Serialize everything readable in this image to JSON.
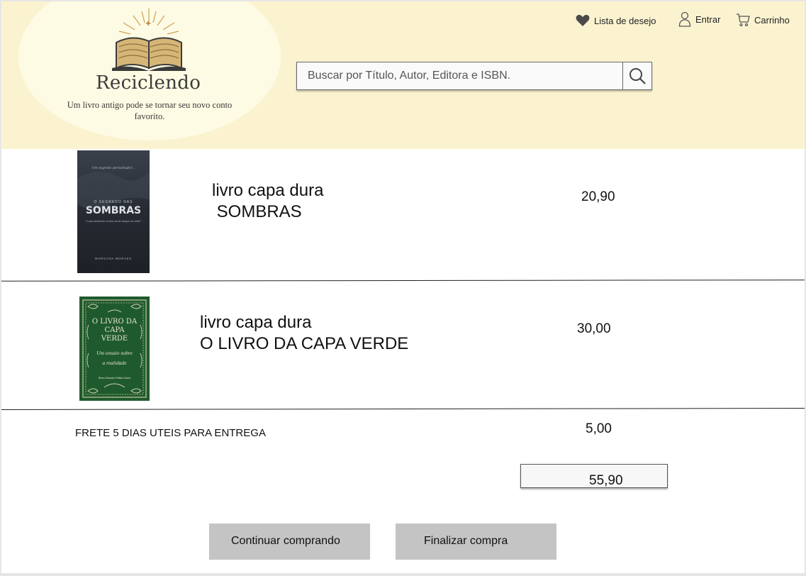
{
  "header": {
    "brand_name": "Reciclendo",
    "tagline": "Um livro antigo pode se tornar seu novo conto favorito.",
    "nav": {
      "wishlist_label": "Lista de desejo",
      "login_label": "Entrar",
      "cart_label": "Carrinho"
    },
    "search": {
      "placeholder": "Buscar por Título, Autor, Editora e ISBN."
    }
  },
  "cart": {
    "items": [
      {
        "line1": "livro capa dura",
        "line2": " SOMBRAS",
        "price": "20,90",
        "cover": {
          "top_text": "Um segredo perturbador...",
          "small_title": "O SEGREDO NAS",
          "big_title": "SOMBRAS",
          "subtitle": "O que aconteceu na ilha vai de sangue ao chão?",
          "author": "MORGANA MORAES"
        }
      },
      {
        "line1": "livro capa dura",
        "line2": "O LIVRO DA CAPA VERDE",
        "price": "30,00",
        "cover": {
          "title_l1": "O LIVRO DA",
          "title_l2": "CAPA",
          "title_l3": "VERDE",
          "subtitle_l1": "Um ensaio sobre",
          "subtitle_l2": "a realidade",
          "author": "Bruno Eduardo Freitas Cunha"
        }
      }
    ],
    "shipping_label": "FRETE 5 DIAS UTEIS PARA ENTREGA",
    "shipping_price": "5,00",
    "total": "55,90"
  },
  "actions": {
    "continue_label": "Continuar comprando",
    "checkout_label": "Finalizar compra"
  },
  "colors": {
    "header_bg": "#fbf3d0",
    "button_bg": "#c4c4c4",
    "green_cover": "#1f5a2e",
    "dark_cover": "#2a2f36"
  }
}
